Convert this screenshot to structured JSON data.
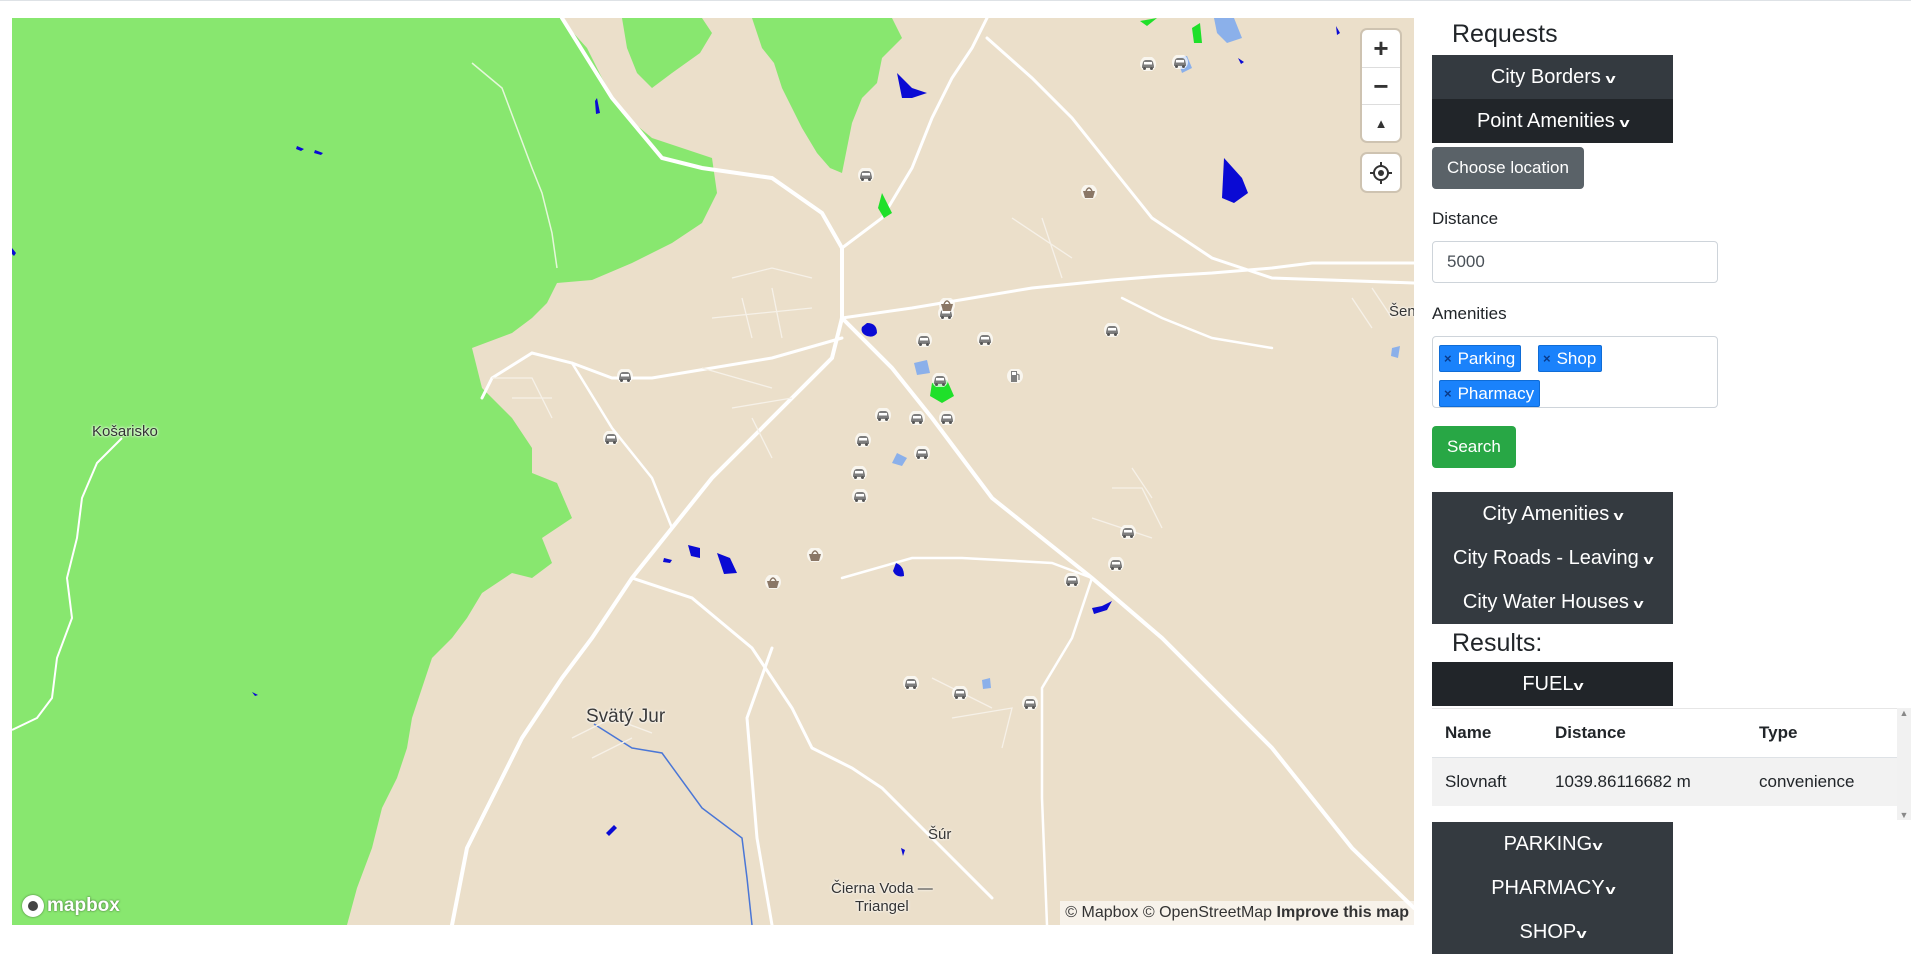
{
  "map": {
    "place_labels": {
      "kosarisko": "Košarisko",
      "svaty_jur": "Svätý Jur",
      "sur": "Šúr",
      "cierna_voda": "Čierna Voda —",
      "triangel": "Triangel",
      "sen": "Šen"
    },
    "controls": {
      "zoom_in": "+",
      "zoom_out": "−",
      "compass": "▲"
    },
    "logo": "mapbox",
    "attribution": {
      "mapbox": "© Mapbox",
      "osm": "© OpenStreetMap",
      "improve": "Improve this map"
    },
    "colors": {
      "forest": "#88e76f",
      "land": "#ebdfca",
      "road": "#ffffff",
      "water_building": "#0a0ad4",
      "park": "#1fe02a",
      "light_blue": "#8bb0ea"
    }
  },
  "panel": {
    "requests_heading": "Requests",
    "city_borders": "City Borders",
    "point_amenities": "Point Amenities",
    "choose_location": "Choose location",
    "distance_label": "Distance",
    "distance_value": "5000",
    "amenities_label": "Amenities",
    "amenity_tags": [
      "Parking",
      "Shop",
      "Pharmacy"
    ],
    "search": "Search",
    "city_amenities": "City Amenities",
    "city_roads_leaving": "City Roads - Leaving",
    "city_water_houses": "City Water Houses",
    "results_heading": "Results:",
    "fuel": "FUEL",
    "table": {
      "headers": [
        "Name",
        "Distance",
        "Type"
      ],
      "rows": [
        [
          "Slovnaft",
          "1039.86116682 m",
          "convenience"
        ]
      ]
    },
    "parking": "PARKING",
    "pharmacy": "PHARMACY",
    "shop": "SHOP"
  }
}
